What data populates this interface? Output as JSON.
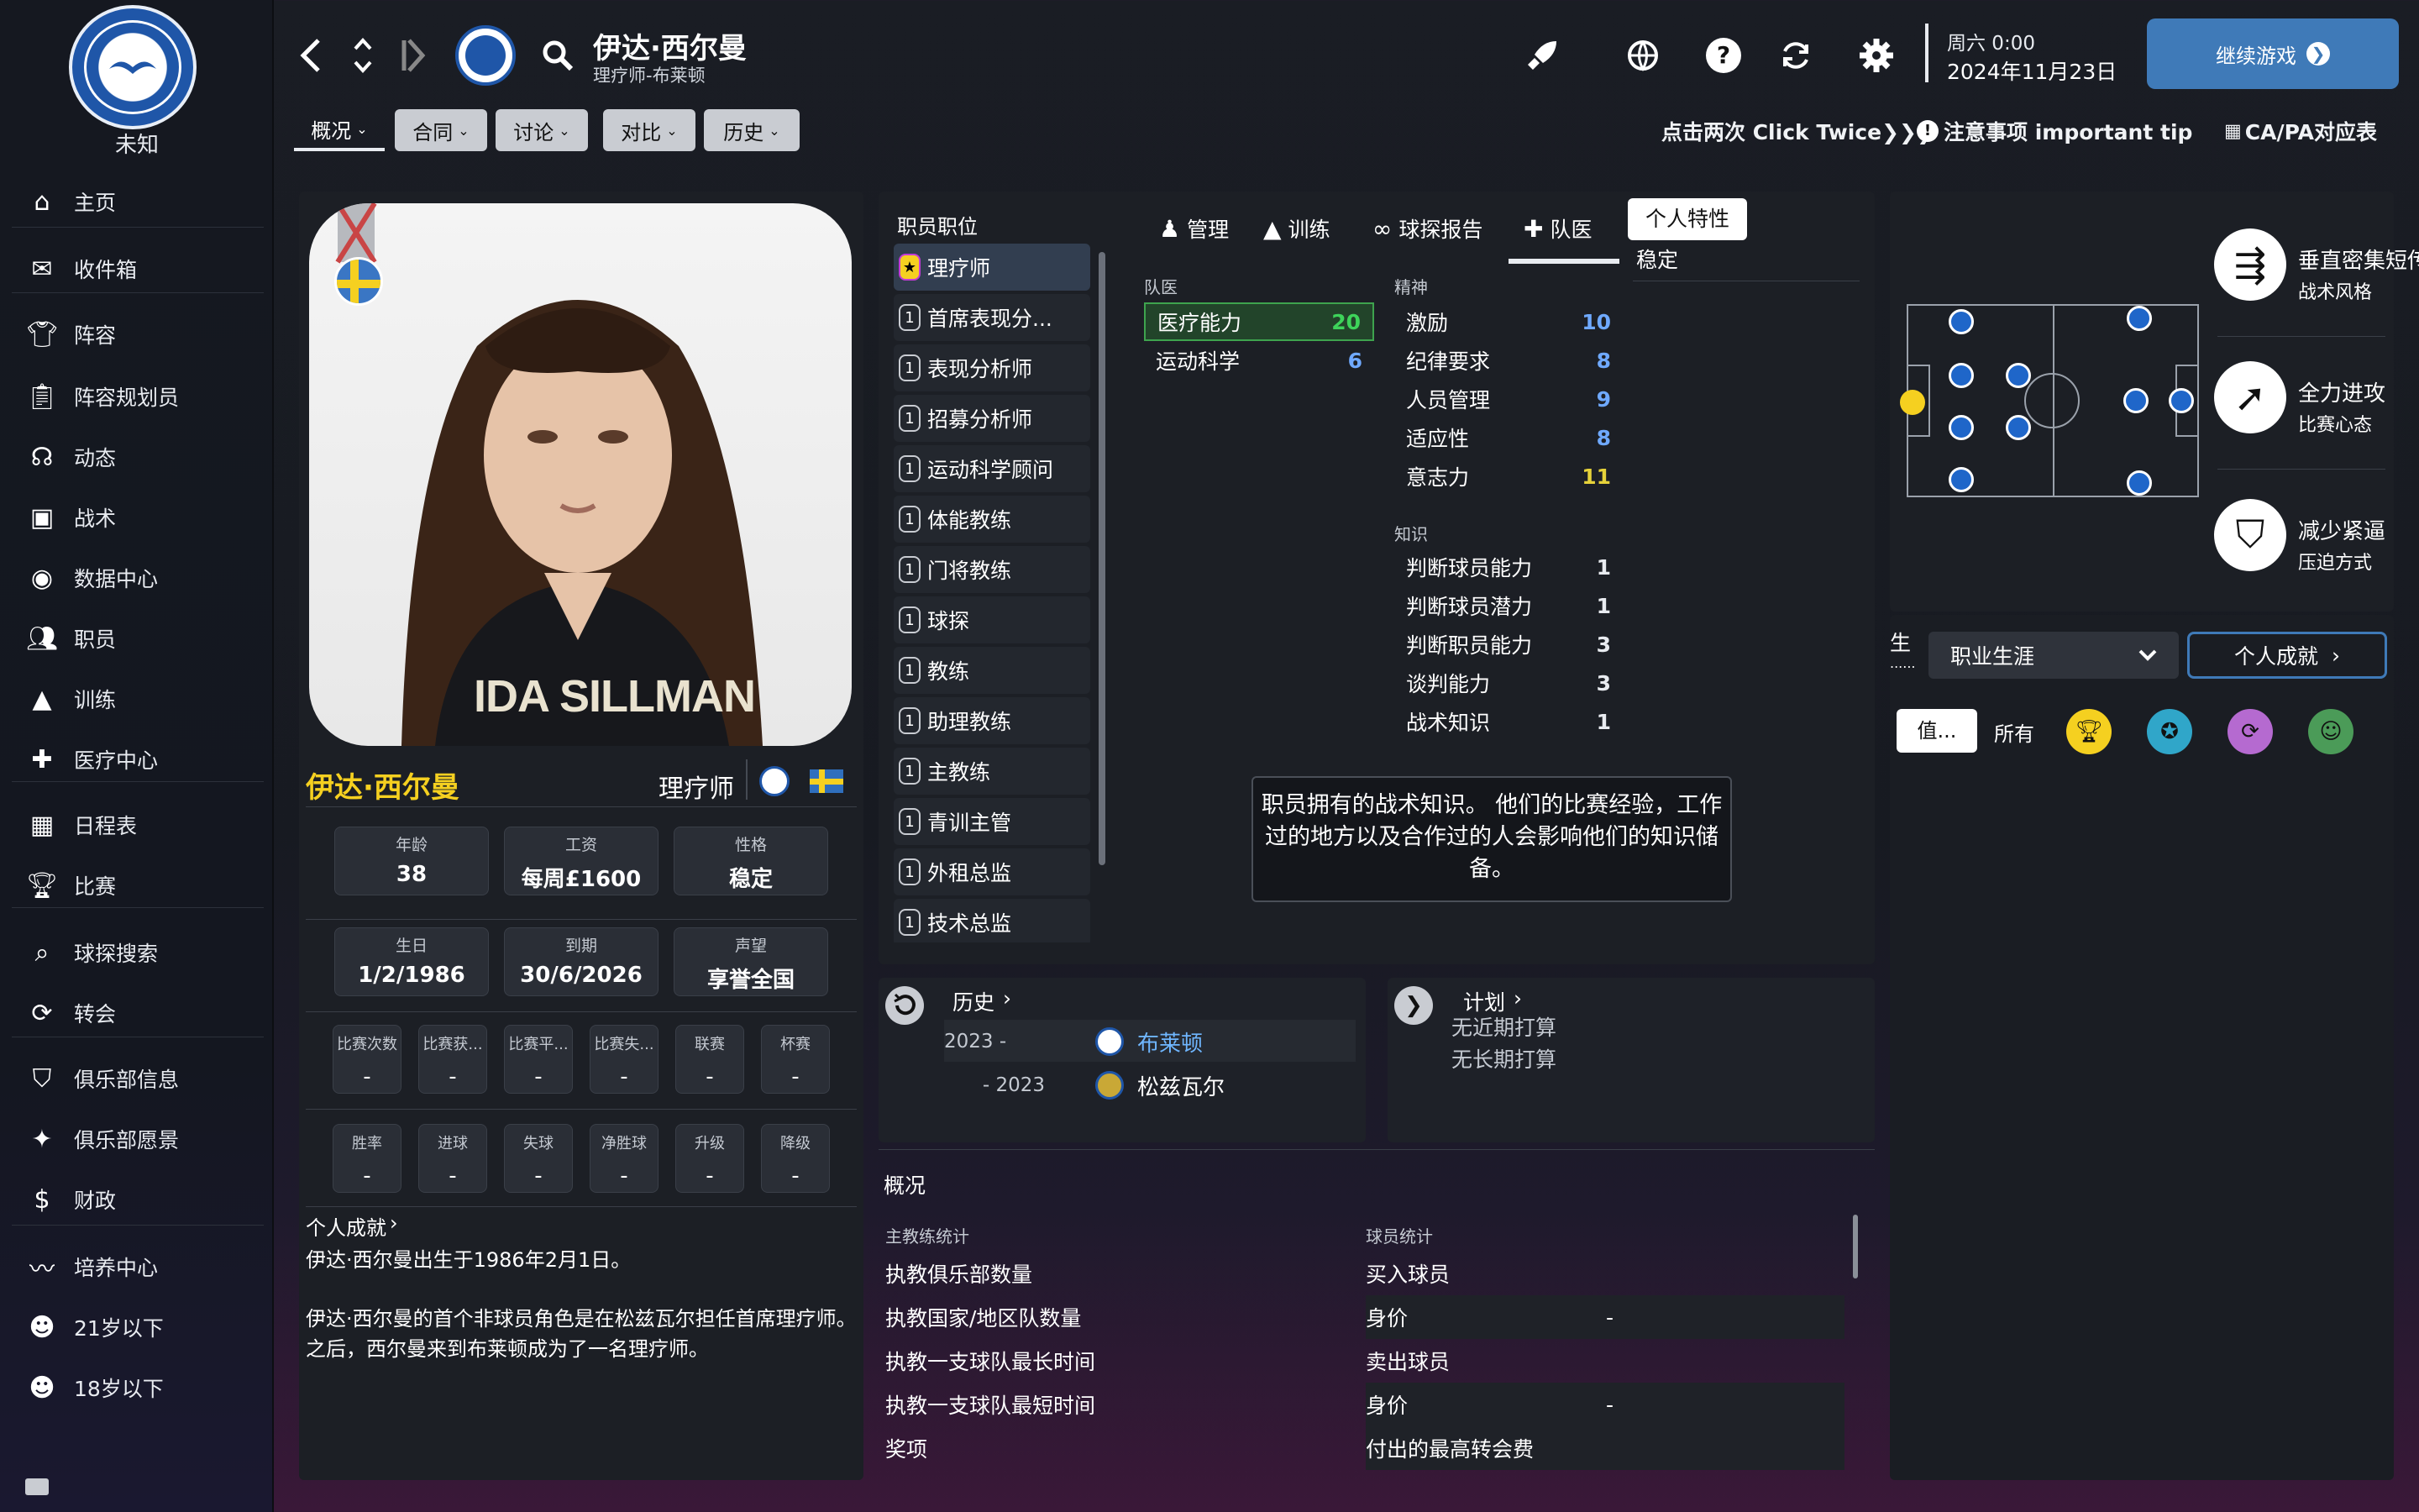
{
  "club": {
    "name": "未知"
  },
  "sidebar": {
    "items": [
      {
        "label": "主页",
        "icon": "home-icon"
      },
      {
        "label": "收件箱",
        "icon": "inbox-icon"
      },
      {
        "label": "阵容",
        "icon": "shirt-icon"
      },
      {
        "label": "阵容规划员",
        "icon": "clipboard-icon"
      },
      {
        "label": "动态",
        "icon": "news-icon"
      },
      {
        "label": "战术",
        "icon": "tactics-icon"
      },
      {
        "label": "数据中心",
        "icon": "data-icon"
      },
      {
        "label": "职员",
        "icon": "staff-icon"
      },
      {
        "label": "训练",
        "icon": "training-icon"
      },
      {
        "label": "医疗中心",
        "icon": "medical-icon"
      },
      {
        "label": "日程表",
        "icon": "calendar-icon"
      },
      {
        "label": "比赛",
        "icon": "trophy-icon"
      },
      {
        "label": "球探搜索",
        "icon": "search-icon"
      },
      {
        "label": "转会",
        "icon": "transfer-icon"
      },
      {
        "label": "俱乐部信息",
        "icon": "shield-icon"
      },
      {
        "label": "俱乐部愿景",
        "icon": "vision-icon"
      },
      {
        "label": "财政",
        "icon": "finance-icon"
      },
      {
        "label": "培养中心",
        "icon": "development-icon"
      },
      {
        "label": "21岁以下",
        "icon": "u21-icon"
      },
      {
        "label": "18岁以下",
        "icon": "u18-icon"
      }
    ]
  },
  "header": {
    "name": "伊达·西尔曼",
    "subtitle": "理疗师-布莱顿",
    "day": "周六 0:00",
    "date": "2024年11月23日",
    "continue": "继续游戏"
  },
  "tabs": [
    "概况",
    "合同",
    "讨论",
    "对比",
    "历史"
  ],
  "tips": {
    "click_twice": "点击两次 Click Twice❯❯❯",
    "important": "注意事项 important tip",
    "capa": "CA/PA对应表"
  },
  "profile": {
    "photo_caption": "IDA SILLMAN",
    "name": "伊达·西尔曼",
    "role": "理疗师",
    "stats": [
      {
        "k": "年龄",
        "v": "38"
      },
      {
        "k": "工资",
        "v": "每周£1600"
      },
      {
        "k": "性格",
        "v": "稳定"
      },
      {
        "k": "生日",
        "v": "1/2/1986"
      },
      {
        "k": "到期",
        "v": "30/6/2026"
      },
      {
        "k": "声望",
        "v": "享誉全国"
      }
    ],
    "match_stats": [
      {
        "k": "比赛次数",
        "v": "-"
      },
      {
        "k": "比赛获...",
        "v": "-"
      },
      {
        "k": "比赛平...",
        "v": "-"
      },
      {
        "k": "比赛失...",
        "v": "-"
      },
      {
        "k": "联赛",
        "v": "-"
      },
      {
        "k": "杯赛",
        "v": "-"
      }
    ],
    "result_stats": [
      {
        "k": "胜率",
        "v": "-"
      },
      {
        "k": "进球",
        "v": "-"
      },
      {
        "k": "失球",
        "v": "-"
      },
      {
        "k": "净胜球",
        "v": "-"
      },
      {
        "k": "升级",
        "v": "-"
      },
      {
        "k": "降级",
        "v": "-"
      }
    ],
    "achievements_link": "个人成就",
    "bio1": "伊达·西尔曼出生于1986年2月1日。",
    "bio2": "伊达·西尔曼的首个非球员角色是在松兹瓦尔担任首席理疗师。 之后，西尔曼来到布莱顿成为了一名理疗师。"
  },
  "staff_roles": {
    "title": "职员职位",
    "items": [
      {
        "num": "★",
        "label": "理疗师"
      },
      {
        "num": "1",
        "label": "首席表现分..."
      },
      {
        "num": "1",
        "label": "表现分析师"
      },
      {
        "num": "1",
        "label": "招募分析师"
      },
      {
        "num": "1",
        "label": "运动科学顾问"
      },
      {
        "num": "1",
        "label": "体能教练"
      },
      {
        "num": "1",
        "label": "门将教练"
      },
      {
        "num": "1",
        "label": "球探"
      },
      {
        "num": "1",
        "label": "教练"
      },
      {
        "num": "1",
        "label": "助理教练"
      },
      {
        "num": "1",
        "label": "主教练"
      },
      {
        "num": "1",
        "label": "青训主管"
      },
      {
        "num": "1",
        "label": "外租总监"
      },
      {
        "num": "1",
        "label": "技术总监"
      }
    ]
  },
  "attr_tabs": [
    "管理",
    "训练",
    "球探报告",
    "队医"
  ],
  "traits": {
    "button": "个人特性",
    "value": "稳定"
  },
  "medical": {
    "title": "队医",
    "rows": [
      {
        "k": "医疗能力",
        "v": "20"
      },
      {
        "k": "运动科学",
        "v": "6"
      }
    ]
  },
  "mental": {
    "title": "精神",
    "rows": [
      {
        "k": "激励",
        "v": "10"
      },
      {
        "k": "纪律要求",
        "v": "8"
      },
      {
        "k": "人员管理",
        "v": "9"
      },
      {
        "k": "适应性",
        "v": "8"
      },
      {
        "k": "意志力",
        "v": "11"
      }
    ]
  },
  "knowledge": {
    "title": "知识",
    "rows": [
      {
        "k": "判断球员能力",
        "v": "1"
      },
      {
        "k": "判断球员潜力",
        "v": "1"
      },
      {
        "k": "判断职员能力",
        "v": "3"
      },
      {
        "k": "谈判能力",
        "v": "3"
      },
      {
        "k": "战术知识",
        "v": "1"
      }
    ]
  },
  "tooltip": "职员拥有的战术知识。 他们的比赛经验，工作过的地方以及合作过的人会影响他们的知识储备。",
  "history": {
    "title": "历史",
    "rows": [
      {
        "period": "2023 -",
        "club": "布莱顿"
      },
      {
        "period": "- 2023",
        "club": "松兹瓦尔"
      }
    ]
  },
  "plans": {
    "title": "计划",
    "rows": [
      "无近期打算",
      "无长期打算"
    ]
  },
  "overview": {
    "title": "概况",
    "coach_label": "主教练统计",
    "player_label": "球员统计",
    "coach_rows": [
      "执教俱乐部数量",
      "执教国家/地区队数量",
      "执教一支球队最长时间",
      "执教一支球队最短时间",
      "奖项"
    ],
    "player_rows": [
      {
        "k": "买入球员",
        "v": ""
      },
      {
        "k": "身价",
        "v": "-"
      },
      {
        "k": "卖出球员",
        "v": ""
      },
      {
        "k": "身价",
        "v": "-"
      },
      {
        "k": "付出的最高转会费",
        "v": ""
      }
    ]
  },
  "tactics": [
    {
      "title": "垂直密集短传",
      "sub": "战术风格",
      "icon": "passing-icon"
    },
    {
      "title": "全力进攻",
      "sub": "比赛心态",
      "icon": "attack-arrow-icon"
    },
    {
      "title": "减少紧逼",
      "sub": "压迫方式",
      "icon": "shield-icon"
    }
  ],
  "career": {
    "label": "生",
    "dots": "......",
    "select": "职业生涯",
    "achievements": "个人成就",
    "filters": [
      "值...",
      "所有"
    ]
  }
}
